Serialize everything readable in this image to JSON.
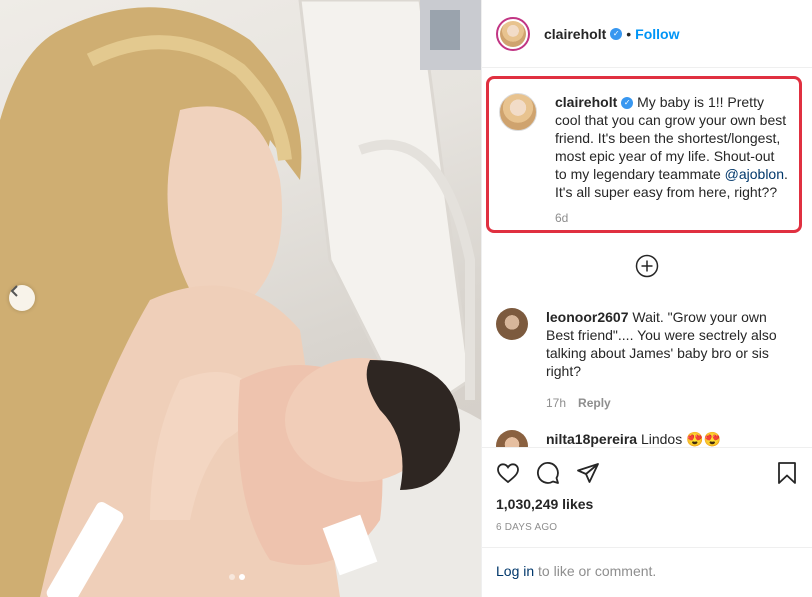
{
  "post": {
    "username": "claireholt",
    "follow_label": "Follow",
    "separator": "•",
    "verified_glyph": "✓",
    "caption_parts": {
      "before_mention": "My baby is 1!! Pretty cool that you can grow your own best friend. It's been the shortest/longest, most epic year of my life. Shout-out to my legendary teammate ",
      "mention": "@ajoblon",
      "after_mention": ". It's all super easy from here, right??"
    },
    "caption_age": "6d",
    "likes": "1,030,249 likes",
    "date": "6 DAYS AGO",
    "carousel": {
      "total_slides": 2,
      "active_slide": 2
    }
  },
  "comments": [
    {
      "username": "leonoor2607",
      "text": "Wait. \"Grow your own Best friend\".... You were sectrely also talking about James' baby bro or sis right?",
      "age": "17h",
      "reply_label": "Reply"
    },
    {
      "username": "nilta18pereira",
      "text": "Lindos 😍😍"
    }
  ],
  "footer": {
    "login_link": "Log in",
    "login_suffix": " to like or comment."
  },
  "icons": {
    "prev": "chevron-left-icon",
    "load_more": "plus-circle-icon",
    "like": "heart-icon",
    "comment": "comment-bubble-icon",
    "share": "paper-plane-icon",
    "save": "bookmark-icon"
  },
  "colors": {
    "link_blue": "#0095f6",
    "highlight_border": "#e03040",
    "verified": "#3897f0",
    "muted": "#8e8e8e"
  }
}
